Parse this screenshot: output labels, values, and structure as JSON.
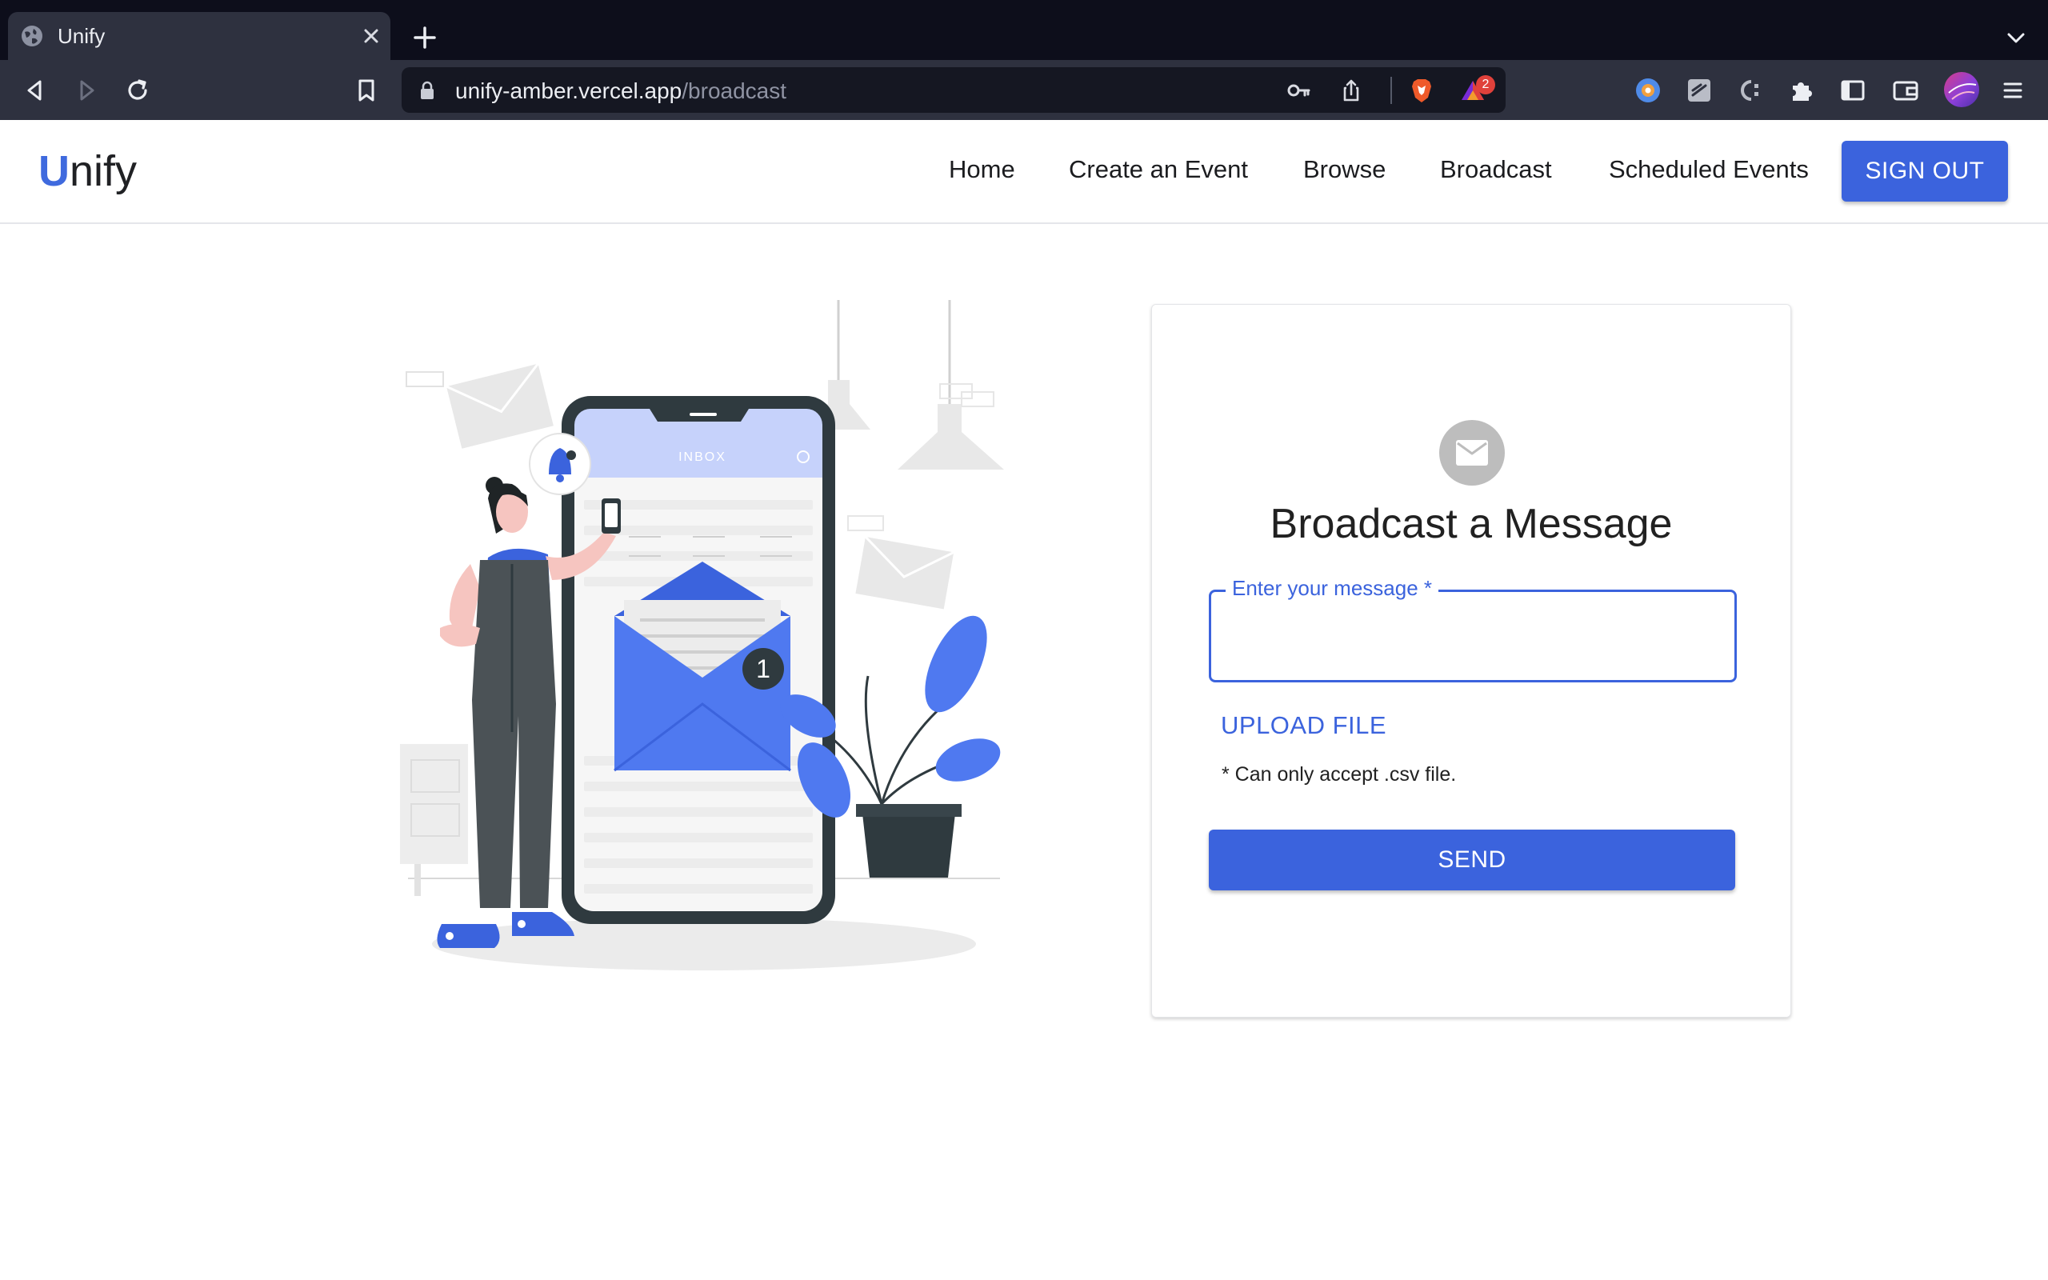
{
  "browser": {
    "tab_title": "Unify",
    "url_host": "unify-amber.vercel.app",
    "url_path": "/broadcast",
    "brave_badge_count": "2",
    "chrome_colors": {
      "tabstrip": "#0d0e1b",
      "toolbar": "#2e313f",
      "omnibox": "#151722"
    }
  },
  "header": {
    "logo_initial": "U",
    "logo_rest": "nify",
    "nav": [
      "Home",
      "Create an Event",
      "Browse",
      "Broadcast",
      "Scheduled Events"
    ],
    "signout_label": "SIGN OUT"
  },
  "card": {
    "icon": "mail-icon",
    "title": "Broadcast a Message",
    "message_label": "Enter your message *",
    "message_value": "",
    "upload_label": "UPLOAD FILE",
    "hint": "* Can only accept .csv file.",
    "send_label": "SEND"
  },
  "illustration": {
    "inbox_label": "INBOX",
    "unread_badge": "1"
  },
  "theme": {
    "accent": "#3b63dd",
    "text": "#212121"
  }
}
